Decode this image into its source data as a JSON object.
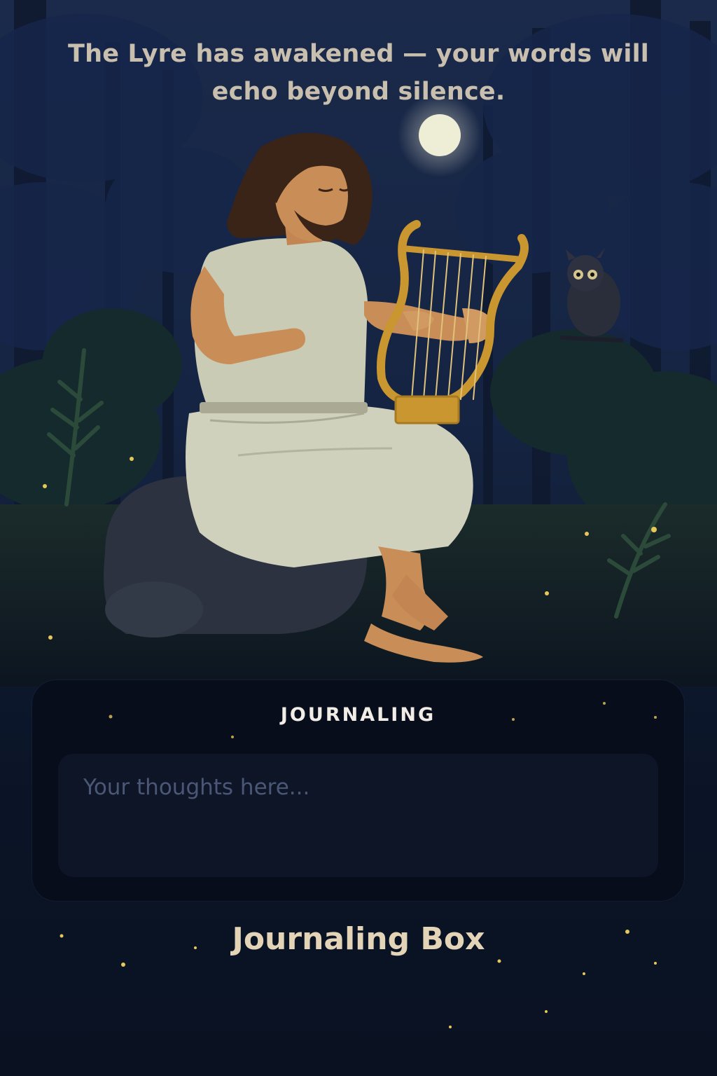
{
  "header": {
    "headline": "The Lyre has awakened — your words will echo beyond silence."
  },
  "journal": {
    "title": "JOURNALING",
    "placeholder": "Your thoughts here...",
    "value": ""
  },
  "caption": "Journaling Box",
  "colors": {
    "background": "#12203c",
    "card": "#080d1b",
    "input": "#0e1526",
    "headline_text": "#c9bfae",
    "caption_text": "#e3d4b8",
    "firefly": "#e6c75a"
  }
}
